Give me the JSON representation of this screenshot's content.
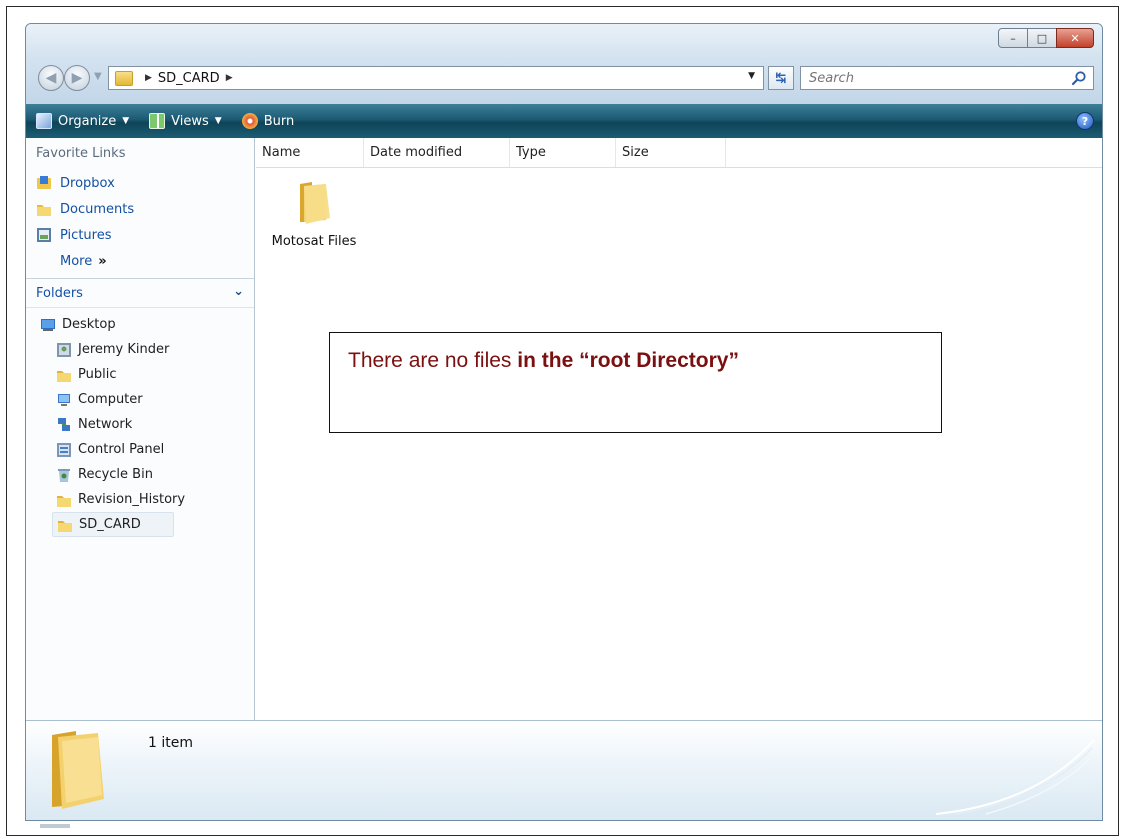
{
  "window": {
    "controls": {
      "minimize": "–",
      "maximize": "□",
      "close": "✕"
    }
  },
  "navigation": {
    "breadcrumb": [
      "SD_CARD"
    ],
    "search_placeholder": "Search"
  },
  "toolbar": {
    "items": [
      {
        "label": "Organize",
        "icon": "organize-icon"
      },
      {
        "label": "Views",
        "icon": "views-icon"
      },
      {
        "label": "Burn",
        "icon": "burn-icon"
      }
    ],
    "help": "?"
  },
  "nav_pane": {
    "favorites_header": "Favorite Links",
    "favorites": [
      {
        "label": "Dropbox",
        "icon": "dropbox-icon"
      },
      {
        "label": "Documents",
        "icon": "documents-folder-icon"
      },
      {
        "label": "Pictures",
        "icon": "pictures-icon"
      }
    ],
    "more_label": "More",
    "more_glyph": "»",
    "folders_header": "Folders",
    "tree": [
      {
        "label": "Desktop",
        "icon": "desktop-icon",
        "level": 0
      },
      {
        "label": "Jeremy Kinder",
        "icon": "user-folder-icon",
        "level": 1
      },
      {
        "label": "Public",
        "icon": "folder-icon",
        "level": 1
      },
      {
        "label": "Computer",
        "icon": "computer-icon",
        "level": 1
      },
      {
        "label": "Network",
        "icon": "network-icon",
        "level": 1
      },
      {
        "label": "Control Panel",
        "icon": "control-panel-icon",
        "level": 1
      },
      {
        "label": "Recycle Bin",
        "icon": "recycle-bin-icon",
        "level": 1
      },
      {
        "label": "Revision_History",
        "icon": "folder-icon",
        "level": 1
      },
      {
        "label": "SD_CARD",
        "icon": "folder-icon",
        "level": 1,
        "selected": true
      }
    ]
  },
  "content": {
    "columns": [
      "Name",
      "Date modified",
      "Type",
      "Size"
    ],
    "items": [
      {
        "name": "Motosat Files",
        "icon": "folder-icon"
      }
    ]
  },
  "details": {
    "count": "1 item"
  },
  "annotation": {
    "text_normal": "There are no files ",
    "text_bold": "in the “root Directory”"
  },
  "colors": {
    "toolbar": "#1c5a73",
    "link": "#1450a3",
    "annotation_text": "#7a1010"
  }
}
